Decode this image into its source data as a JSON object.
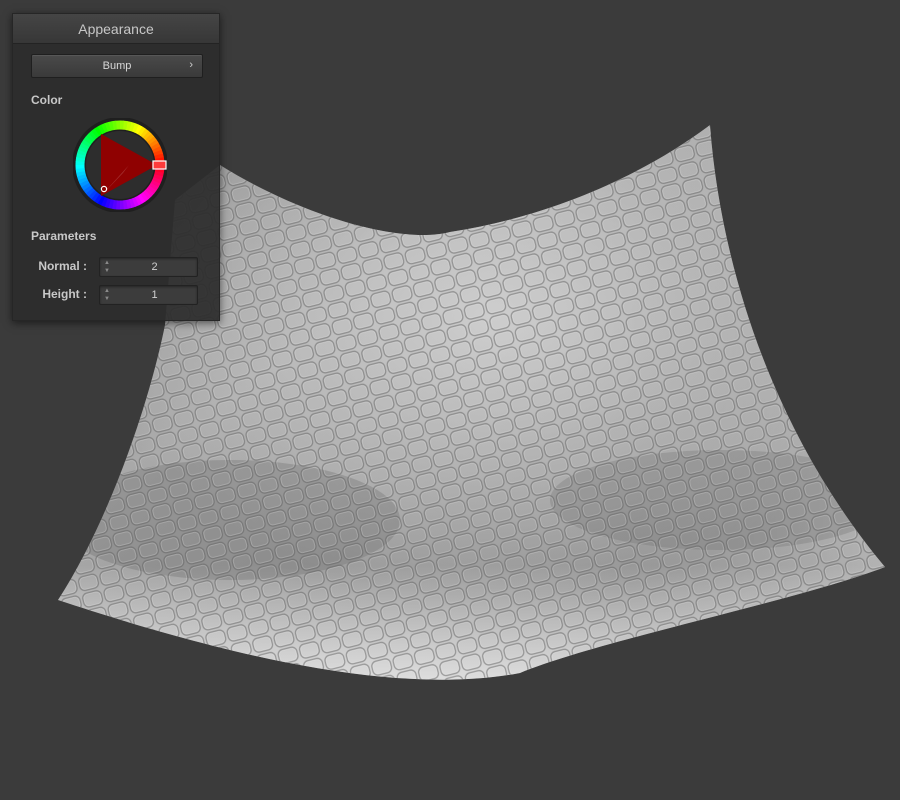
{
  "panel": {
    "title": "Appearance",
    "mode_dropdown": {
      "value": "Bump",
      "icon": "chevron-right-icon"
    },
    "color_section": {
      "label": "Color",
      "selected_hue": "#ff0000"
    },
    "parameters_section": {
      "label": "Parameters",
      "fields": [
        {
          "label": "Normal :",
          "value": "2"
        },
        {
          "label": "Height :",
          "value": "1"
        }
      ]
    }
  },
  "viewport": {
    "background": "#3b3b3b"
  }
}
